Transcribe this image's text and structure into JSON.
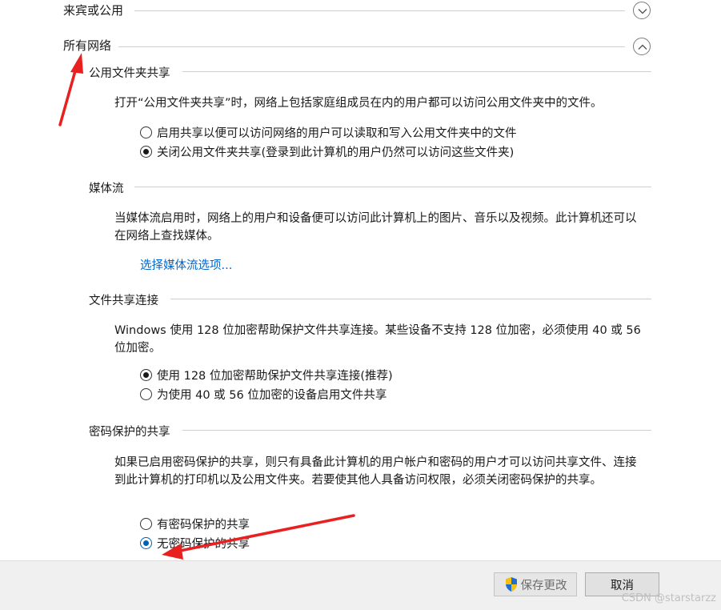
{
  "sections": {
    "guest": {
      "title": "来宾或公用"
    },
    "all_networks": {
      "title": "所有网络"
    }
  },
  "public_folder": {
    "title": "公用文件夹共享",
    "desc": "打开“公用文件夹共享”时，网络上包括家庭组成员在内的用户都可以访问公用文件夹中的文件。",
    "options": [
      {
        "label": "启用共享以便可以访问网络的用户可以读取和写入公用文件夹中的文件",
        "checked": false
      },
      {
        "label": "关闭公用文件夹共享(登录到此计算机的用户仍然可以访问这些文件夹)",
        "checked": true
      }
    ]
  },
  "media": {
    "title": "媒体流",
    "desc": "当媒体流启用时，网络上的用户和设备便可以访问此计算机上的图片、音乐以及视频。此计算机还可以在网络上查找媒体。",
    "link": "选择媒体流选项..."
  },
  "file_sharing": {
    "title": "文件共享连接",
    "desc": "Windows 使用 128 位加密帮助保护文件共享连接。某些设备不支持 128 位加密，必须使用 40 或 56 位加密。",
    "options": [
      {
        "label": "使用 128 位加密帮助保护文件共享连接(推荐)",
        "checked": true
      },
      {
        "label": "为使用 40 或 56 位加密的设备启用文件共享",
        "checked": false
      }
    ]
  },
  "password": {
    "title": "密码保护的共享",
    "desc": "如果已启用密码保护的共享，则只有具备此计算机的用户帐户和密码的用户才可以访问共享文件、连接到此计算机的打印机以及公用文件夹。若要使其他人具备访问权限，必须关闭密码保护的共享。",
    "options": [
      {
        "label": "有密码保护的共享",
        "checked": false
      },
      {
        "label": "无密码保护的共享",
        "checked": true
      }
    ]
  },
  "footer": {
    "save": "保存更改",
    "cancel": "取消"
  },
  "watermark": "CSDN @starstarzz",
  "colors": {
    "annotation_arrow": "#e8201f",
    "link": "#0066cc",
    "radio_focus": "#0063b1"
  },
  "icons": {
    "expand": "chevron-down-icon",
    "collapse": "chevron-up-icon",
    "shield": "uac-shield-icon"
  }
}
